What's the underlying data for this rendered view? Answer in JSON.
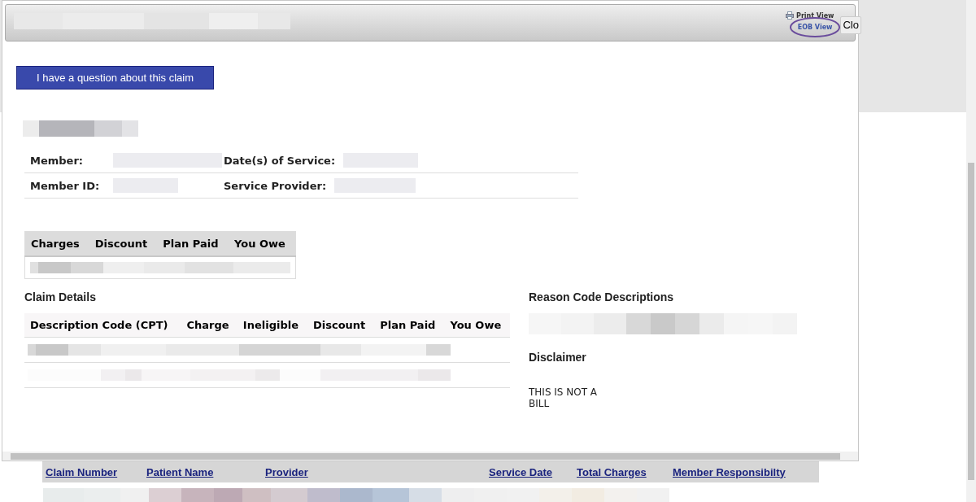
{
  "dialog": {
    "title_bar": {
      "links": [
        {
          "label": "Print View",
          "kind": "print",
          "circled": false
        },
        {
          "label": "EOB View",
          "kind": "eob",
          "circled": true
        }
      ],
      "close_label": "Clo"
    },
    "question_button": "I have a question about this claim",
    "member_info": [
      {
        "label": "Member:"
      },
      {
        "label": "Date(s) of Service:"
      },
      {
        "label": "Member ID:"
      },
      {
        "label": "Service Provider:"
      }
    ],
    "summary_table": {
      "columns": [
        "Charges",
        "Discount",
        "Plan Paid",
        "You Owe"
      ]
    },
    "claim_details": {
      "title": "Claim Details",
      "columns": [
        "Description Code (CPT)",
        "Charge",
        "Ineligible",
        "Discount",
        "Plan Paid",
        "You Owe"
      ]
    },
    "reason_codes": {
      "title": "Reason Code Descriptions"
    },
    "disclaimer": {
      "title": "Disclaimer",
      "text": "THIS IS NOT A BILL"
    }
  },
  "claims_table": {
    "columns": [
      "Claim Number",
      "Patient Name",
      "Provider",
      "Service Date",
      "Total Charges",
      "Member Responsibilty"
    ]
  }
}
